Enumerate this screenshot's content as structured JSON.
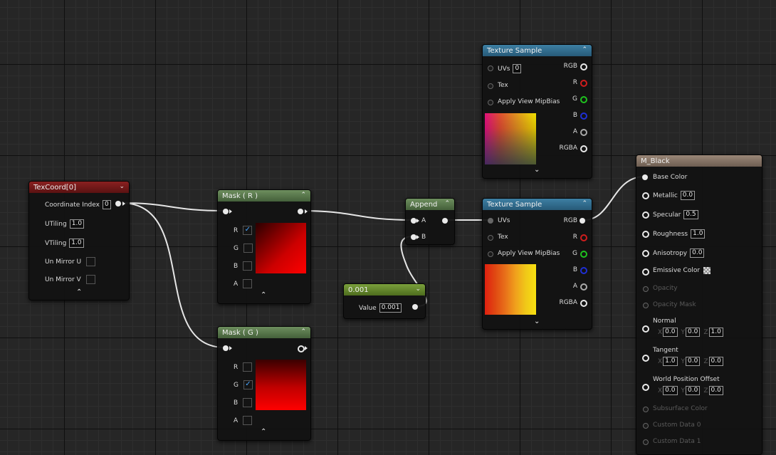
{
  "texcoord": {
    "title": "TexCoord[0]",
    "coord_index_label": "Coordinate Index",
    "coord_index": "0",
    "utiling_label": "UTiling",
    "utiling": "1.0",
    "vtiling_label": "VTiling",
    "vtiling": "1.0",
    "mirror_u_label": "Un Mirror U",
    "mirror_v_label": "Un Mirror V"
  },
  "mask_r": {
    "title": "Mask ( R )",
    "channels": [
      "R",
      "G",
      "B",
      "A"
    ],
    "checked": "R"
  },
  "mask_g": {
    "title": "Mask ( G )",
    "channels": [
      "R",
      "G",
      "B",
      "A"
    ],
    "checked": "G"
  },
  "append": {
    "title": "Append",
    "in_a": "A",
    "in_b": "B"
  },
  "constant": {
    "title": "0.001",
    "value_label": "Value",
    "value": "0.001"
  },
  "tex_sample_top": {
    "title": "Texture Sample",
    "uvs_label": "UVs",
    "uvs_value": "0",
    "tex_label": "Tex",
    "mip_label": "Apply View MipBias",
    "outputs": [
      "RGB",
      "R",
      "G",
      "B",
      "A",
      "RGBA"
    ]
  },
  "tex_sample_mid": {
    "title": "Texture Sample",
    "uvs_label": "UVs",
    "tex_label": "Tex",
    "mip_label": "Apply View MipBias",
    "outputs": [
      "RGB",
      "R",
      "G",
      "B",
      "A",
      "RGBA"
    ]
  },
  "material": {
    "title": "M_Black",
    "base_color": "Base Color",
    "metallic": "Metallic",
    "metallic_value": "0.0",
    "specular": "Specular",
    "specular_value": "0.5",
    "roughness": "Roughness",
    "roughness_value": "1.0",
    "anisotropy": "Anisotropy",
    "anisotropy_value": "0.0",
    "emissive": "Emissive Color",
    "opacity": "Opacity",
    "opacity_mask": "Opacity Mask",
    "normal": "Normal",
    "normal_xyz": [
      "0.0",
      "0.0",
      "1.0"
    ],
    "tangent": "Tangent",
    "tangent_xyz": [
      "1.0",
      "0.0",
      "0.0"
    ],
    "wpo": "World Position Offset",
    "wpo_xyz": [
      "0.0",
      "0.0",
      "0.0"
    ],
    "subsurface": "Subsurface Color",
    "custom0": "Custom Data 0",
    "custom1": "Custom Data 1",
    "axis_labels": [
      "X",
      "Y",
      "Z"
    ]
  },
  "colors": {
    "output_r": "#d11d1d",
    "output_g": "#1fc41f",
    "output_b": "#1f2fd6",
    "wire": "#e6e6e6"
  }
}
